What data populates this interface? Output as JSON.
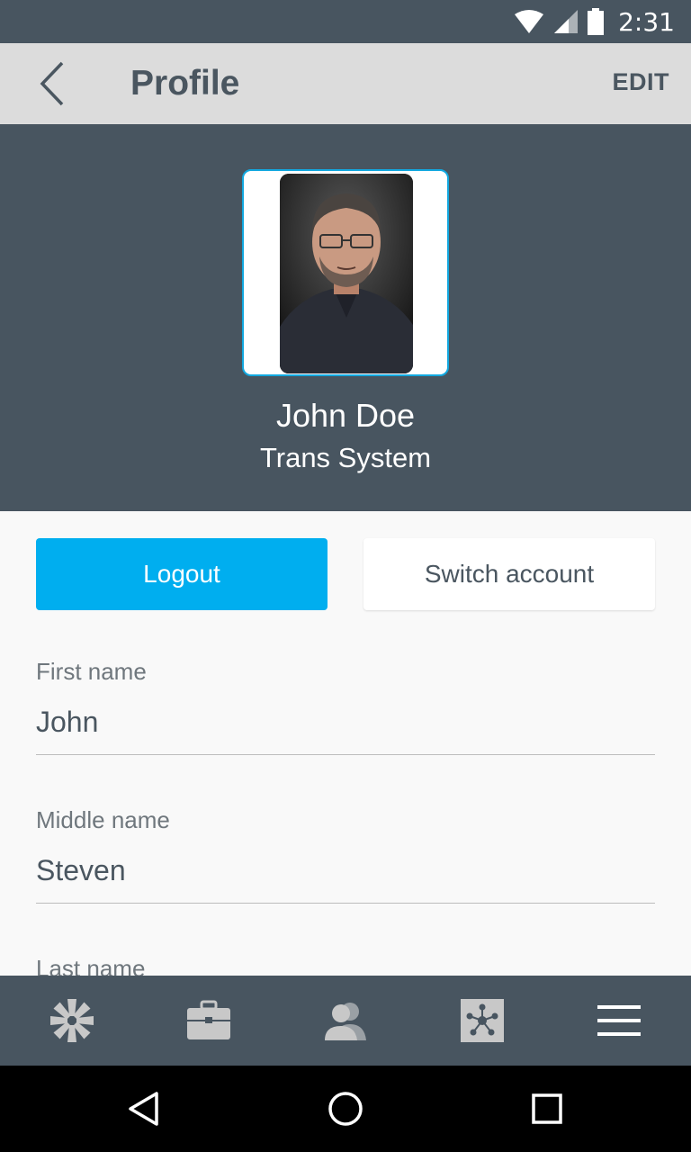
{
  "status_bar": {
    "time": "2:31",
    "icons": [
      "wifi-icon",
      "cell-signal-icon",
      "battery-icon"
    ]
  },
  "app_bar": {
    "title": "Profile",
    "edit_label": "EDIT",
    "back_icon": "back-arrow-icon"
  },
  "profile": {
    "name": "John Doe",
    "organization": "Trans System"
  },
  "actions": {
    "logout_label": "Logout",
    "switch_label": "Switch account"
  },
  "fields": [
    {
      "label": "First name",
      "value": "John"
    },
    {
      "label": "Middle name",
      "value": "Steven"
    },
    {
      "label": "Last name",
      "value": ""
    }
  ],
  "bottom_nav": {
    "items": [
      "pinwheel-icon",
      "briefcase-icon",
      "contacts-icon",
      "network-icon",
      "menu-icon"
    ]
  },
  "system_nav": {
    "items": [
      "back-icon",
      "home-icon",
      "recents-icon"
    ]
  },
  "colors": {
    "header": "#485560",
    "app_bar": "#dcdcdc",
    "accent": "#00aeef",
    "text_dark": "#4a5660"
  }
}
